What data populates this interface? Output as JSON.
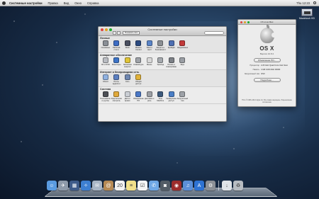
{
  "menubar": {
    "app": "Системные настройки",
    "items": [
      "Правка",
      "Вид",
      "Окно",
      "Справка"
    ],
    "clock": "Thu 12:23"
  },
  "desktop": {
    "hd_label": "Macintosh HD"
  },
  "prefs": {
    "title": "Системные настройки",
    "show_all": "Показать все",
    "sections": [
      {
        "title": "Личные",
        "items": [
          {
            "label": "Основные",
            "icon": "general-icon",
            "color": "#8a8f96"
          },
          {
            "label": "Рабочий стол и заставка",
            "icon": "desktop-icon",
            "color": "#3d6cc4"
          },
          {
            "label": "Dock",
            "icon": "dock-icon",
            "color": "#4a4f60"
          },
          {
            "label": "Mission Control",
            "icon": "mission-control-icon",
            "color": "#2c4b80"
          },
          {
            "label": "Язык и текст",
            "icon": "language-icon",
            "color": "#5a84c8"
          },
          {
            "label": "Защита и безопасность",
            "icon": "security-icon",
            "color": "#8b8f94"
          },
          {
            "label": "Spotlight",
            "icon": "spotlight-icon",
            "color": "#4e6fb2"
          },
          {
            "label": "Уведомления",
            "icon": "notifications-icon",
            "color": "#c23a3a"
          }
        ]
      },
      {
        "title": "Аппаратное обеспечение",
        "items": [
          {
            "label": "CD и DVD",
            "icon": "cd-icon",
            "color": "#b9bcc2"
          },
          {
            "label": "Мониторы",
            "icon": "displays-icon",
            "color": "#3c73c7"
          },
          {
            "label": "Экономия энергии",
            "icon": "energy-icon",
            "color": "#e0c437"
          },
          {
            "label": "Клавиатура",
            "icon": "keyboard-icon",
            "color": "#9ea2a8"
          },
          {
            "label": "Мышь",
            "icon": "mouse-icon",
            "color": "#d8d8d8"
          },
          {
            "label": "Трекпад",
            "icon": "trackpad-icon",
            "color": "#a5a9ae"
          },
          {
            "label": "Печать и сканирование",
            "icon": "printer-icon",
            "color": "#7d8187"
          },
          {
            "label": "Звук",
            "icon": "sound-icon",
            "color": "#9a9ea4"
          }
        ]
      },
      {
        "title": "Интернет и беспроводная сеть",
        "items": [
          {
            "label": "iCloud",
            "icon": "icloud-icon",
            "color": "#8fb1e0"
          },
          {
            "label": "Почта, адреса и календари",
            "icon": "mail-icon",
            "color": "#5b7fc0"
          },
          {
            "label": "Сеть",
            "icon": "network-icon",
            "color": "#6f86b0"
          },
          {
            "label": "Общий доступ",
            "icon": "sharing-icon",
            "color": "#e1b23a"
          }
        ]
      },
      {
        "title": "Система",
        "items": [
          {
            "label": "Пользователи и группы",
            "icon": "users-icon",
            "color": "#4c4f55"
          },
          {
            "label": "Родительский контроль",
            "icon": "parental-icon",
            "color": "#e0a93b"
          },
          {
            "label": "Дата и время",
            "icon": "date-icon",
            "color": "#c9cdd3"
          },
          {
            "label": "Обновление ПО",
            "icon": "update-icon",
            "color": "#4b78c6"
          },
          {
            "label": "Диктовка и речь",
            "icon": "dictation-icon",
            "color": "#9b9fa5"
          },
          {
            "label": "Time Machine",
            "icon": "time-machine-icon",
            "color": "#3d5a7d"
          },
          {
            "label": "Универсальный доступ",
            "icon": "accessibility-icon",
            "color": "#4a7ec6"
          },
          {
            "label": "Загрузочный том",
            "icon": "startup-disk-icon",
            "color": "#9da1a7"
          }
        ]
      }
    ]
  },
  "about": {
    "title": "Об этом Mac",
    "os_name": "OS X",
    "version": "Версия 10.8.2",
    "update_button": "Обновление ПО...",
    "rows": [
      {
        "key": "Процессор",
        "value": "2.26 GHz Quad Core Intel Xeon"
      },
      {
        "key": "Память",
        "value": "4 GB 1333 MHz DDR3"
      },
      {
        "key": "Загрузочный том",
        "value": "OSX"
      }
    ],
    "more_button": "Подробнее...",
    "copyright": "TM и © 1983–2012 Apple Inc. Все права защищены. Лицензионное соглашение"
  },
  "dock": {
    "items": [
      {
        "name": "finder-icon",
        "color": "#5a9be0",
        "glyph": "☺"
      },
      {
        "name": "launchpad-icon",
        "color": "#8e9aaa",
        "glyph": "✈"
      },
      {
        "name": "mission-control-icon",
        "color": "#3e5b8a",
        "glyph": "▦"
      },
      {
        "name": "safari-icon",
        "color": "#3d7fd1",
        "glyph": "✧"
      },
      {
        "name": "mail-icon",
        "color": "#a9b6c6",
        "glyph": "✉"
      },
      {
        "name": "contacts-icon",
        "color": "#b68a55",
        "glyph": "@"
      },
      {
        "name": "calendar-icon",
        "color": "#f2f2f2",
        "glyph": "20"
      },
      {
        "name": "notes-icon",
        "color": "#f1e08a",
        "glyph": "≡"
      },
      {
        "name": "reminders-icon",
        "color": "#f5f5f5",
        "glyph": "☑"
      },
      {
        "name": "messages-icon",
        "color": "#6fa8e6",
        "glyph": "✆"
      },
      {
        "name": "facetime-icon",
        "color": "#525c66",
        "glyph": "◙"
      },
      {
        "name": "photo-booth-icon",
        "color": "#9c2c2c",
        "glyph": "◉"
      },
      {
        "name": "itunes-icon",
        "color": "#5b8fd8",
        "glyph": "♫"
      },
      {
        "name": "app-store-icon",
        "color": "#2e73d3",
        "glyph": "A"
      },
      {
        "name": "system-preferences-icon",
        "color": "#8c9096",
        "glyph": "⚙"
      },
      {
        "name": "downloads-icon",
        "color": "#dfe3e8",
        "glyph": "↓"
      },
      {
        "name": "trash-icon",
        "color": "#b7bcc2",
        "glyph": "♻"
      }
    ]
  }
}
